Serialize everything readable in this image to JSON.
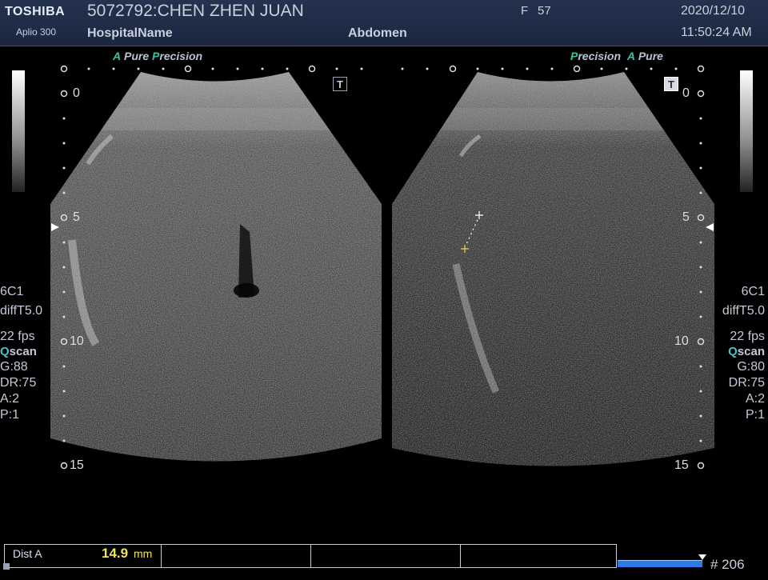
{
  "header": {
    "brand": "TOSHIBA",
    "model": "Aplio 300",
    "patient": "5072792:CHEN ZHEN JUAN",
    "hospital": "HospitalName",
    "sex": "F",
    "age": "57",
    "exam": "Abdomen",
    "date": "2020/12/10",
    "time": "11:50:24 AM"
  },
  "left_panel": {
    "brand_a": "A",
    "brand_pure": "Pure",
    "brand_p": "P",
    "brand_recision": "recision",
    "t_icon": "T",
    "depth_labels": [
      "0",
      "5",
      "10",
      "15"
    ],
    "probe": "6C1",
    "harmonic": "diffT5.0",
    "fps": "22 fps",
    "scan_q": "Q",
    "scan_rest": "scan",
    "gain": "G:88",
    "dr": "DR:75",
    "a": "A:2",
    "p": "P:1"
  },
  "right_panel": {
    "brand_p": "P",
    "brand_recision": "recision",
    "brand_a": "A",
    "brand_pure": "Pure",
    "t_icon": "T",
    "depth_labels": [
      "0",
      "5",
      "10",
      "15"
    ],
    "probe": "6C1",
    "harmonic": "diffT5.0",
    "fps": "22 fps",
    "scan_q": "Q",
    "scan_rest": "scan",
    "gain": "G:80",
    "dr": "DR:75",
    "a": "A:2",
    "p": "P:1"
  },
  "measurement": {
    "label": "Dist A",
    "value": "14.9",
    "unit": "mm"
  },
  "cine": {
    "frame": "# 206"
  },
  "colors": {
    "header_bg": "#1b2740",
    "accent_teal": "#3cc1a5",
    "measure_yellow": "#f1e35a",
    "cine_blue": "#2c7be5"
  }
}
